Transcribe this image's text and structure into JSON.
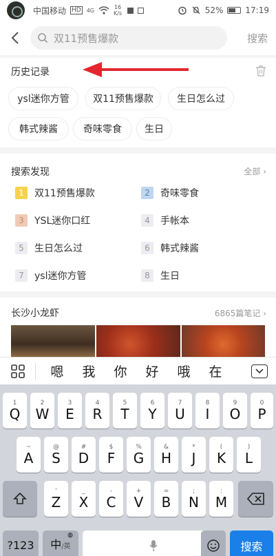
{
  "status_bar": {
    "carrier": "中国移动",
    "hd": "HD",
    "network": "4G",
    "speed_value": "16",
    "speed_unit": "K/s",
    "battery": "52%",
    "time": "17:19"
  },
  "search": {
    "query": "双11预售爆款",
    "submit_label": "搜索"
  },
  "history": {
    "title": "历史记录",
    "items": [
      "ysl迷你方管",
      "双11预售爆款",
      "生日怎么过",
      "韩式辣酱",
      "奇味零食",
      "生日"
    ]
  },
  "discover": {
    "title": "搜索发现",
    "all_label": "全部",
    "items": [
      {
        "rank": "1",
        "label": "双11预售爆款",
        "badge_color": "#f7d34a"
      },
      {
        "rank": "2",
        "label": "奇味零食",
        "badge_color": "#bfd6ee"
      },
      {
        "rank": "3",
        "label": "YSL迷你口红",
        "badge_color": "#efcbb6"
      },
      {
        "rank": "4",
        "label": "手帐本",
        "badge_color": "#ececf2"
      },
      {
        "rank": "5",
        "label": "生日怎么过",
        "badge_color": "#ececf2"
      },
      {
        "rank": "6",
        "label": "韩式辣酱",
        "badge_color": "#ececf2"
      },
      {
        "rank": "7",
        "label": "ysl迷你方管",
        "badge_color": "#ececf2"
      },
      {
        "rank": "8",
        "label": "生日",
        "badge_color": "#ececf2"
      }
    ]
  },
  "topic": {
    "title": "长沙小龙虾",
    "note_count": "6865篇笔记"
  },
  "candidates": [
    "嗯",
    "我",
    "你",
    "好",
    "哦",
    "在"
  ],
  "keyboard": {
    "row1": [
      {
        "main": "Q",
        "sub": "1"
      },
      {
        "main": "W",
        "sub": "2"
      },
      {
        "main": "E",
        "sub": "3"
      },
      {
        "main": "R",
        "sub": "4"
      },
      {
        "main": "T",
        "sub": "5"
      },
      {
        "main": "Y",
        "sub": "6"
      },
      {
        "main": "U",
        "sub": "7"
      },
      {
        "main": "I",
        "sub": "8"
      },
      {
        "main": "O",
        "sub": "9"
      },
      {
        "main": "P",
        "sub": "0"
      }
    ],
    "row2": [
      {
        "main": "A",
        "sub": "~"
      },
      {
        "main": "S",
        "sub": "@"
      },
      {
        "main": "D",
        "sub": "#"
      },
      {
        "main": "F",
        "sub": "$"
      },
      {
        "main": "G",
        "sub": "%"
      },
      {
        "main": "H",
        "sub": "&"
      },
      {
        "main": "J",
        "sub": "*"
      },
      {
        "main": "K",
        "sub": "("
      },
      {
        "main": "L",
        "sub": ")"
      }
    ],
    "row3": [
      {
        "main": "Z",
        "sub": "'"
      },
      {
        "main": "X",
        "sub": "_"
      },
      {
        "main": "C",
        "sub": "-"
      },
      {
        "main": "V",
        "sub": "+"
      },
      {
        "main": "B",
        "sub": "="
      },
      {
        "main": "N",
        "sub": ";"
      },
      {
        "main": "M",
        "sub": ":"
      }
    ],
    "symbols_label": "?123",
    "lang_main": "中",
    "lang_sub": "/英",
    "enter_label": "搜索"
  },
  "colors": {
    "accent_red": "#e3262f",
    "enter_blue": "#1a7fe8"
  },
  "icons": [
    "back-icon",
    "search-icon",
    "trash-icon",
    "grid-icon",
    "collapse-keyboard-icon",
    "shift-icon",
    "backspace-icon",
    "globe-icon",
    "microphone-icon",
    "emoji-icon"
  ]
}
